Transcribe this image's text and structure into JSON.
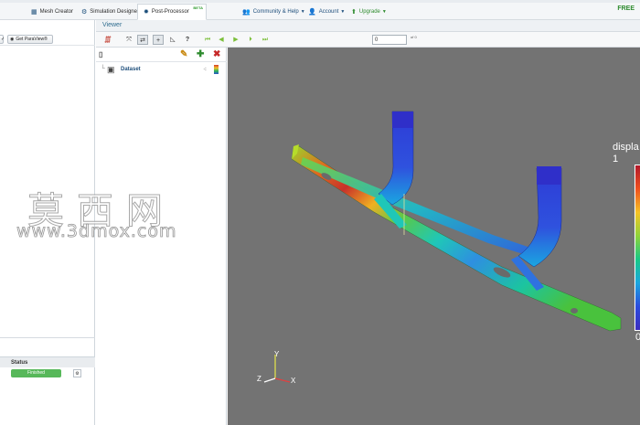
{
  "topbar": {
    "tabs": [
      {
        "label": "Mesh Creator",
        "icon": "grid-icon"
      },
      {
        "label": "Simulation Designer",
        "icon": "gears-icon"
      },
      {
        "label": "Post-Processor",
        "icon": "gear-icon",
        "badge": "BETA",
        "active": true
      }
    ],
    "nav": [
      {
        "label": "Community & Help",
        "icon": "people-icon"
      },
      {
        "label": "Account",
        "icon": "user-icon"
      },
      {
        "label": "Upgrade",
        "icon": "arrow-up-icon"
      }
    ],
    "plan": "FREE"
  },
  "left_panel": {
    "get_paraview_label": "Get ParaView®",
    "status_header": "Status",
    "status_value": "Finished"
  },
  "viewer": {
    "title": "Viewer",
    "time_value": "0",
    "time_of": "of 0"
  },
  "pipeline": {
    "dataset_label": "Dataset"
  },
  "legend": {
    "title": "displa",
    "max": "1",
    "min": "0"
  },
  "axes": {
    "x": "X",
    "y": "Y",
    "z": "Z"
  },
  "watermark": {
    "cn": "莫西网",
    "url": "www.3dmox.com"
  },
  "colors": {
    "accent": "#1f4f7c",
    "viewport": "#737373",
    "status_ok": "#57b85a",
    "free": "#2e8b2e"
  }
}
